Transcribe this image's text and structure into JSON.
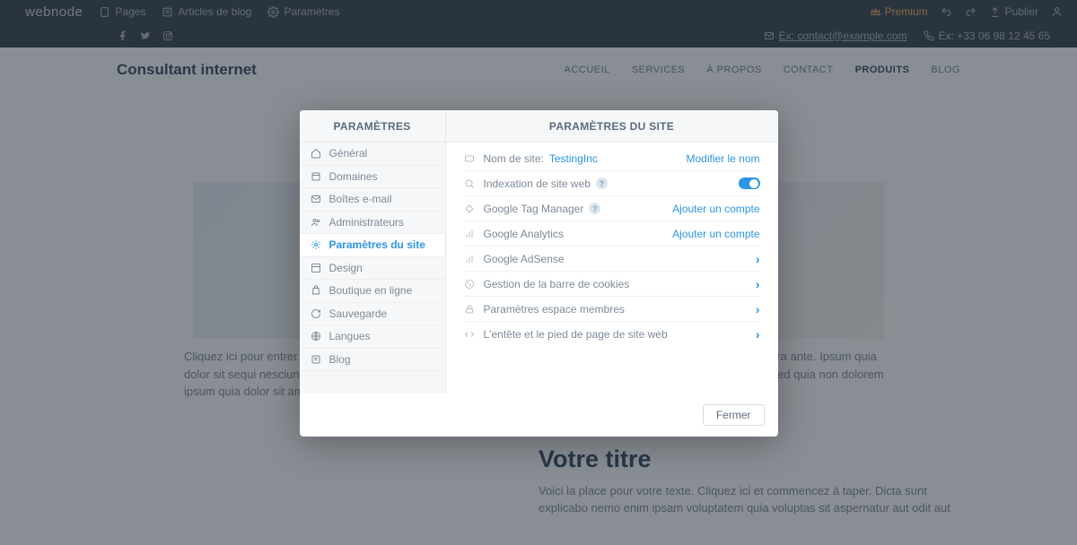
{
  "appbar": {
    "logo": "webnode",
    "nav": {
      "pages": "Pages",
      "blog_articles": "Articles de blog",
      "settings": "Paramètres"
    },
    "right": {
      "premium": "Premium",
      "publish": "Publier"
    }
  },
  "secbar": {
    "email_label": "Ex: contact@example.com",
    "phone_label": "Ex: +33 06 98 12 45 65"
  },
  "site": {
    "title": "Consultant internet",
    "nav": {
      "accueil": "ACCUEIL",
      "services": "SERVICES",
      "apropos": "À PROPOS",
      "contact": "CONTACT",
      "produits": "PRODUITS",
      "blog": "BLOG"
    }
  },
  "bg": {
    "paragraph1": "Cliquez ici pour entrer du texte. Sed ut perspiciatis unde omnis iste natus error sit voluptatem accusantium, et viverra ante. Ipsum quia dolor sit sequi nesciunt neque porro quisquam est qui dolorem ipsum quia dolor sit amet consectetur adipisci velit sed quia non dolorem ipsum quia dolor sit amet consectetur adipiscing elit sed do eiusmod tempor incididunt.",
    "heading2": "Votre titre",
    "paragraph2": "Voici la place pour votre texte. Cliquez ici et commencez à taper. Dicta sunt explicabo nemo enim ipsam voluptatem quia voluptas sit aspernatur aut odit aut"
  },
  "modal": {
    "head_left": "PARAMÈTRES",
    "head_right": "PARAMÈTRES DU SITE",
    "sidebar": {
      "general": "Général",
      "domains": "Domaines",
      "email": "Boîtes e-mail",
      "admins": "Administrateurs",
      "site_settings": "Paramètres du site",
      "design": "Design",
      "shop": "Boutique en ligne",
      "backup": "Sauvegarde",
      "languages": "Langues",
      "blog": "Blog"
    },
    "rows": {
      "sitename_label": "Nom de site:",
      "sitename_value": "TestingInc",
      "sitename_action": "Modifier le nom",
      "indexation_label": "Indexation de site web",
      "gtm_label": "Google Tag Manager",
      "gtm_action": "Ajouter un compte",
      "ga_label": "Google Analytics",
      "ga_action": "Ajouter un compte",
      "adsense_label": "Google AdSense",
      "cookies_label": "Gestion de la barre de cookies",
      "members_label": "Paramètres espace membres",
      "headerfooter_label": "L'entête et le pied de page de site web"
    },
    "close": "Fermer"
  }
}
